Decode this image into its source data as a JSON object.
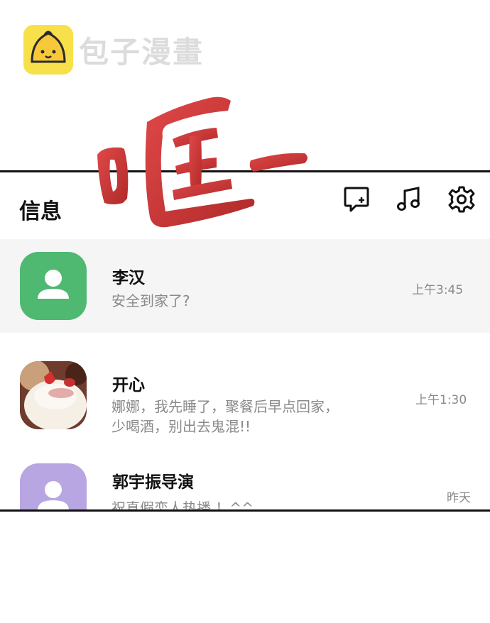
{
  "watermark": {
    "text": "包子漫畫",
    "logo_icon": "bun-icon"
  },
  "sfx": {
    "text": "哐一",
    "color": "#c83a3a"
  },
  "header": {
    "title": "信息",
    "icons": [
      "new-message-icon",
      "music-note-icon",
      "gear-icon"
    ]
  },
  "conversations": [
    {
      "name": "李汉",
      "preview": "安全到家了?",
      "time": "上午3:45",
      "avatar": "default-person-icon",
      "avatar_color": "#4fb871",
      "selected": true
    },
    {
      "name": "开心",
      "preview_line1": "娜娜，我先睡了，聚餐后早点回家，",
      "preview_line2": "少喝酒，别出去鬼混!!",
      "time": "上午1:30",
      "avatar": "cake-photo"
    },
    {
      "name": "郭宇振导演",
      "preview": "祝真假恋人热播 ！^^",
      "time": "昨天",
      "avatar": "default-person-icon",
      "avatar_color": "#b8a6e3"
    }
  ],
  "colors": {
    "frame": "#111111",
    "text_secondary": "#8a8a8a",
    "selected_bg": "#f5f5f5"
  }
}
